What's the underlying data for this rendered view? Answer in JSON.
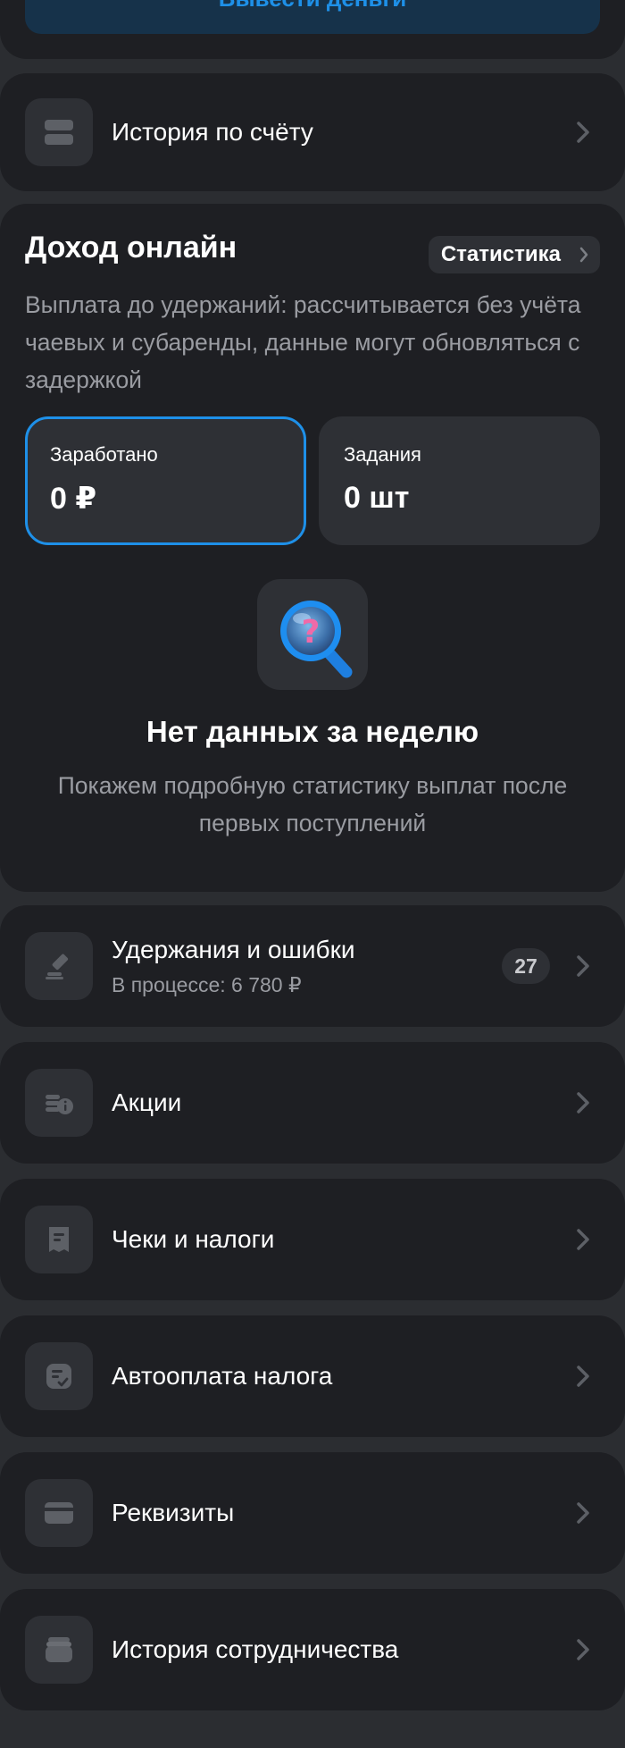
{
  "withdraw": {
    "label": "Вывести деньги"
  },
  "account_history": {
    "label": "История по счёту"
  },
  "income": {
    "title": "Доход онлайн",
    "stats_button": "Статистика",
    "description": "Выплата до удержаний: рассчитывается без учёта чаевых и субаренды, данные могут обновляться с задержкой",
    "tiles": [
      {
        "label": "Заработано",
        "value": "0 ₽",
        "selected": true
      },
      {
        "label": "Задания",
        "value": "0 шт",
        "selected": false
      }
    ],
    "empty_title": "Нет данных за неделю",
    "empty_description": "Покажем подробную статистику выплат после первых поступлений"
  },
  "deductions": {
    "label": "Удержания и ошибки",
    "subtitle": "В процессе: 6 780 ₽",
    "badge": "27"
  },
  "menu": [
    {
      "label": "Акции",
      "icon": "coins-icon"
    },
    {
      "label": "Чеки и налоги",
      "icon": "receipt-icon"
    },
    {
      "label": "Автооплата налога",
      "icon": "auto-tax-icon"
    },
    {
      "label": "Реквизиты",
      "icon": "card-icon"
    },
    {
      "label": "История сотрудничества",
      "icon": "stack-icon"
    }
  ],
  "colors": {
    "background": "#2b2d31",
    "card": "#1e1f23",
    "tile": "#2e3035",
    "accent": "#1e90e8",
    "muted_text": "#9a9ca2"
  }
}
